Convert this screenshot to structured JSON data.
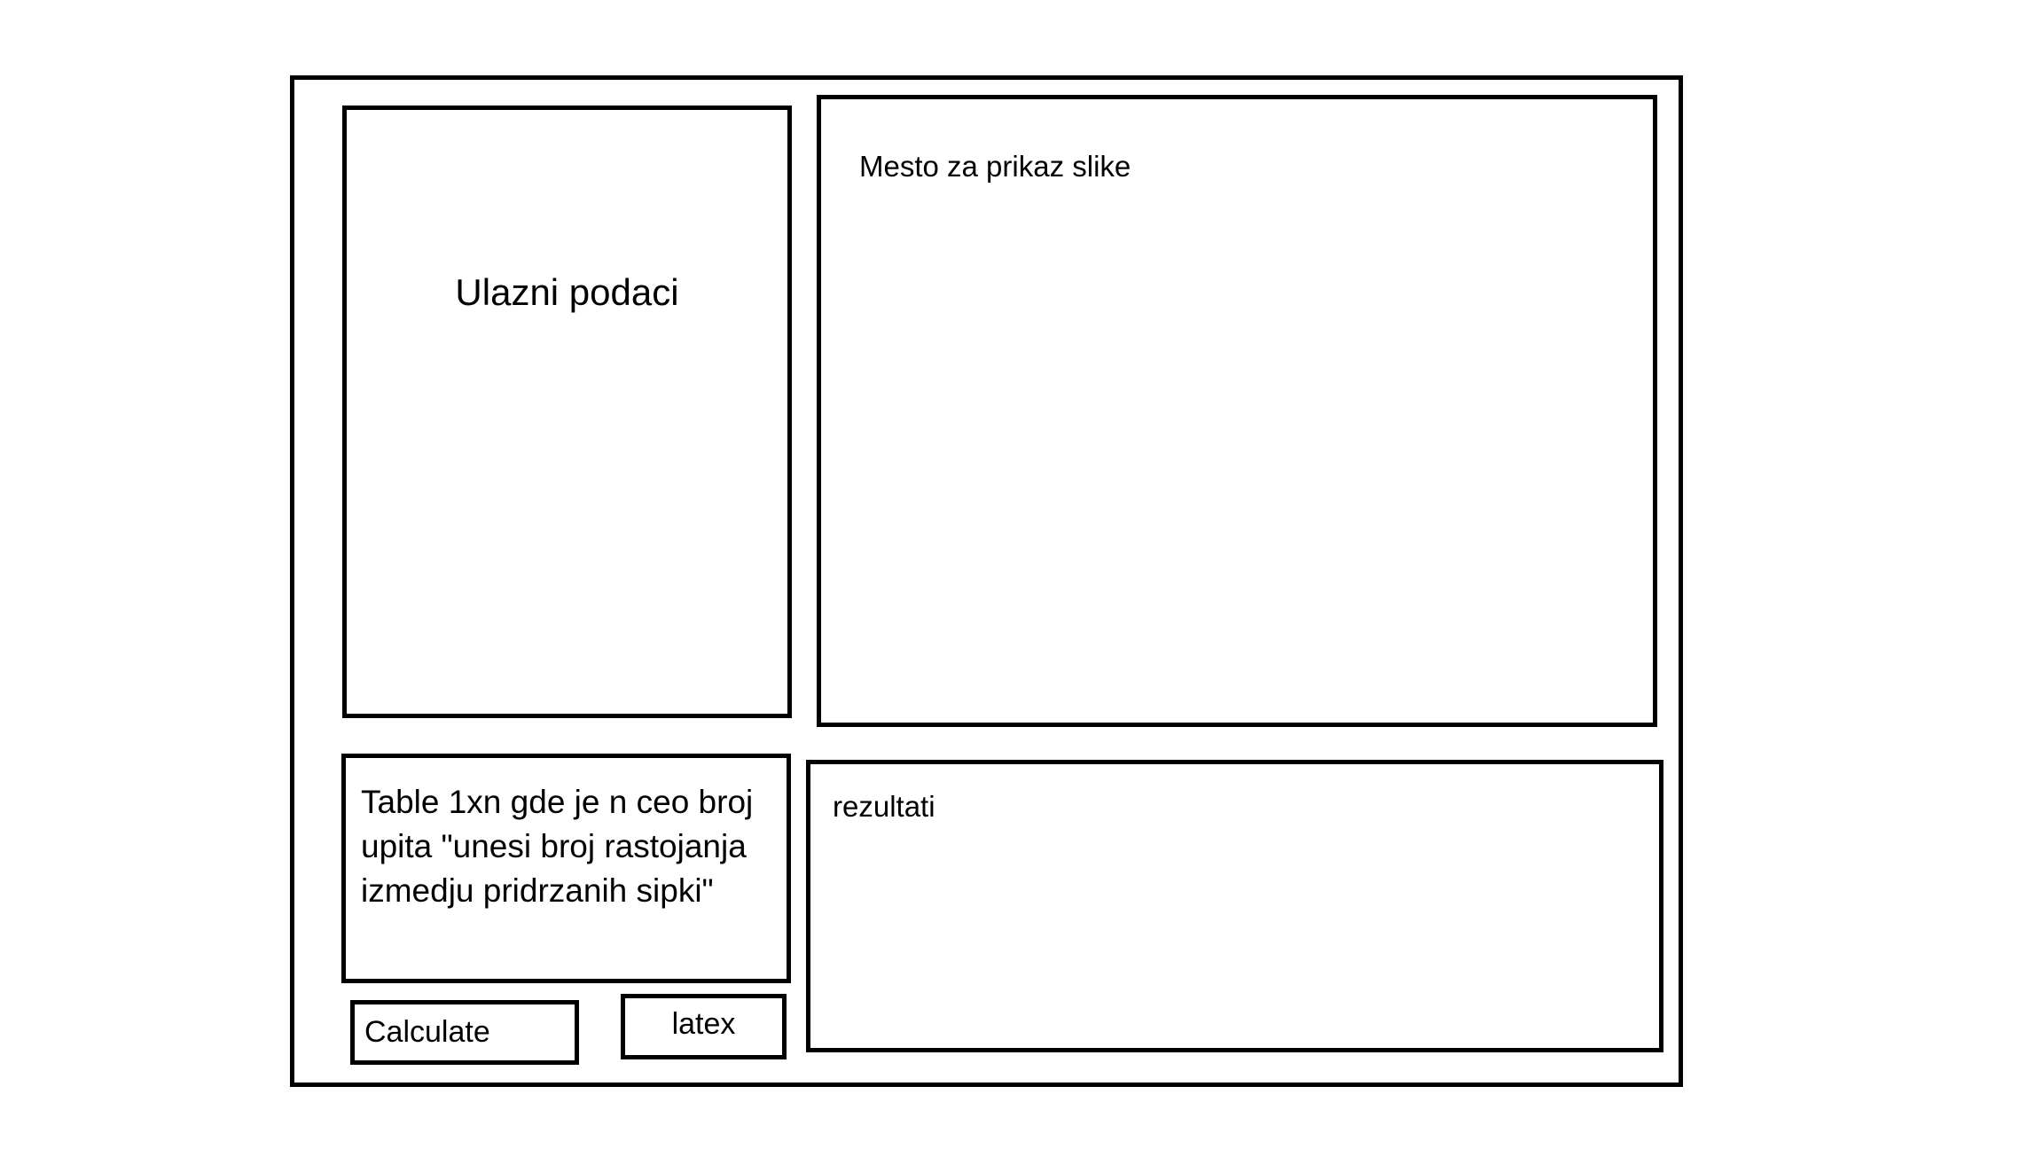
{
  "input_panel": {
    "title": "Ulazni podaci"
  },
  "image_panel": {
    "title": "Mesto za prikaz slike"
  },
  "table_panel": {
    "text": "Table 1xn gde je n ceo broj upita \"unesi broj rastojanja izmedju pridrzanih sipki\""
  },
  "results_panel": {
    "title": "rezultati"
  },
  "buttons": {
    "calculate": "Calculate",
    "latex": "latex"
  }
}
